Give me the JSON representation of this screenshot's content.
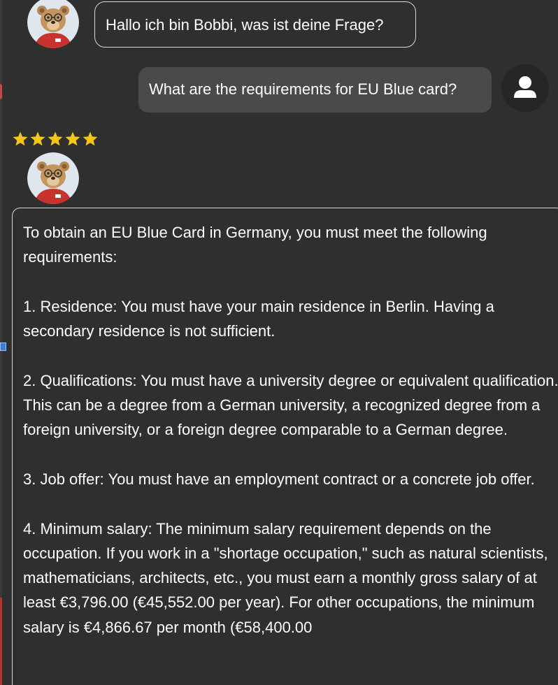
{
  "bot": {
    "name": "Bobbi",
    "greeting": "Hallo ich bin Bobbi, was ist deine Frage?"
  },
  "user": {
    "message": "What are the requirements for EU Blue card?"
  },
  "rating": {
    "stars": 5,
    "max": 5,
    "color": "#f5c518"
  },
  "answer": {
    "paragraphs": [
      "To obtain an EU Blue Card in Germany, you must meet the following requirements:",
      "1. Residence: You must have your main residence in Berlin. Having a secondary residence is not sufficient.",
      "2. Qualifications: You must have a university degree or equivalent qualification. This can be a degree from a German university, a recognized degree from a foreign university, or a foreign degree comparable to a German degree.",
      "3. Job offer: You must have an employment contract or a concrete job offer.",
      "4. Minimum salary: The minimum salary requirement depends on the occupation. If you work in a \"shortage occupation,\" such as natural scientists, mathematicians, architects, etc., you must earn a monthly gross salary of at least €3,796.00 (€45,552.00 per year). For other occupations, the minimum salary is €4,866.67 per month (€58,400.00"
    ]
  },
  "colors": {
    "background": "#2f2f2f",
    "user_bubble": "#4a4a4a",
    "border": "#d9d9d9",
    "text": "#ffffff"
  },
  "icons": {
    "bot_avatar": "bear-avatar-icon",
    "user_avatar": "user-silhouette-icon",
    "star": "star-icon"
  }
}
